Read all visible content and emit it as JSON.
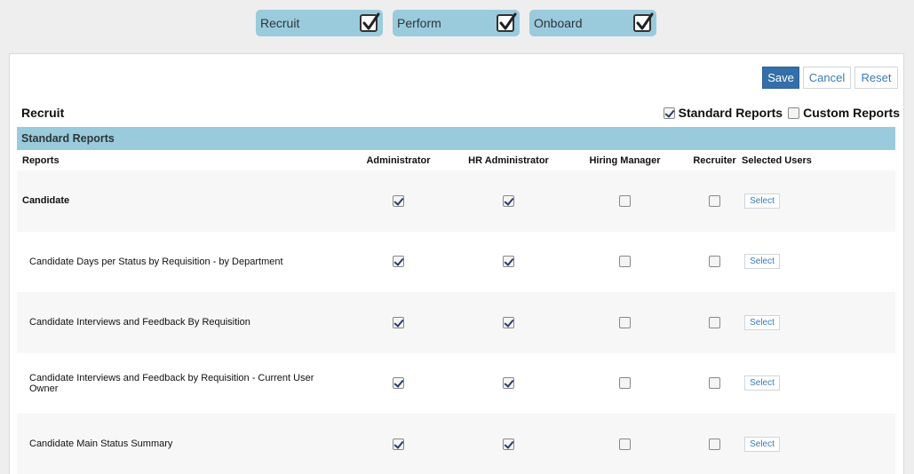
{
  "modules": [
    {
      "label": "Recruit",
      "checked": true
    },
    {
      "label": "Perform",
      "checked": true
    },
    {
      "label": "Onboard",
      "checked": true
    }
  ],
  "toolbar": {
    "save_label": "Save",
    "cancel_label": "Cancel",
    "reset_label": "Reset"
  },
  "section": {
    "title": "Recruit",
    "report_types": [
      {
        "label": "Standard Reports",
        "checked": true
      },
      {
        "label": "Custom Reports",
        "checked": false
      }
    ]
  },
  "standard_reports": {
    "header": "Standard Reports",
    "columns": [
      "Reports",
      "Administrator",
      "HR Administrator",
      "Hiring Manager",
      "Recruiter",
      "Selected Users"
    ],
    "select_label": "Select",
    "rows": [
      {
        "name": "Candidate",
        "category": true,
        "administrator": true,
        "hr_administrator": true,
        "hiring_manager": false,
        "recruiter": false
      },
      {
        "name": "Candidate Days per Status by Requisition - by Department",
        "category": false,
        "administrator": true,
        "hr_administrator": true,
        "hiring_manager": false,
        "recruiter": false
      },
      {
        "name": "Candidate Interviews and Feedback By Requisition",
        "category": false,
        "administrator": true,
        "hr_administrator": true,
        "hiring_manager": false,
        "recruiter": false
      },
      {
        "name": "Candidate Interviews and Feedback by Requisition - Current User Owner",
        "category": false,
        "administrator": true,
        "hr_administrator": true,
        "hiring_manager": false,
        "recruiter": false
      },
      {
        "name": "Candidate Main Status Summary",
        "category": false,
        "administrator": true,
        "hr_administrator": true,
        "hiring_manager": false,
        "recruiter": false
      }
    ]
  }
}
